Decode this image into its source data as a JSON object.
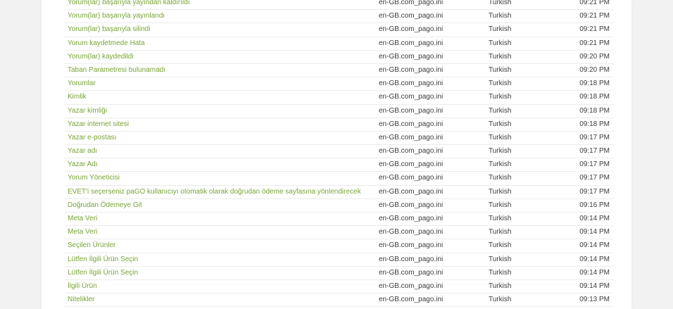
{
  "rows": [
    {
      "text": "Yorum(lar) başarıyla yayından kaldırıldı",
      "file": "en-GB.com_pago.ini",
      "language": "Turkish",
      "time": "09:21 PM"
    },
    {
      "text": "Yorum(lar) başarıyla yayınlandı",
      "file": "en-GB.com_pago.ini",
      "language": "Turkish",
      "time": "09:21 PM"
    },
    {
      "text": "Yorum(lar) başarıyla silindi",
      "file": "en-GB.com_pago.ini",
      "language": "Turkish",
      "time": "09:21 PM"
    },
    {
      "text": "Yorum kaydetmede Hata",
      "file": "en-GB.com_pago.ini",
      "language": "Turkish",
      "time": "09:21 PM"
    },
    {
      "text": "Yorum(lar) kaydedildi",
      "file": "en-GB.com_pago.ini",
      "language": "Turkish",
      "time": "09:20 PM"
    },
    {
      "text": "Taban Parametresi bulunamadı",
      "file": "en-GB.com_pago.ini",
      "language": "Turkish",
      "time": "09:20 PM"
    },
    {
      "text": "Yorumlar",
      "file": "en-GB.com_pago.ini",
      "language": "Turkish",
      "time": "09:18 PM"
    },
    {
      "text": "Kimlik",
      "file": "en-GB.com_pago.ini",
      "language": "Turkish",
      "time": "09:18 PM"
    },
    {
      "text": "Yazar kimliği",
      "file": "en-GB.com_pago.ini",
      "language": "Turkish",
      "time": "09:18 PM"
    },
    {
      "text": "Yazar internet sitesi",
      "file": "en-GB.com_pago.ini",
      "language": "Turkish",
      "time": "09:18 PM"
    },
    {
      "text": "Yazar e-postası",
      "file": "en-GB.com_pago.ini",
      "language": "Turkish",
      "time": "09:17 PM"
    },
    {
      "text": "Yazar adı",
      "file": "en-GB.com_pago.ini",
      "language": "Turkish",
      "time": "09:17 PM"
    },
    {
      "text": "Yazar Adı",
      "file": "en-GB.com_pago.ini",
      "language": "Turkish",
      "time": "09:17 PM"
    },
    {
      "text": "Yorum Yöneticisi",
      "file": "en-GB.com_pago.ini",
      "language": "Turkish",
      "time": "09:17 PM"
    },
    {
      "text": "EVET'i seçerseniz paGO kullanıcıyı otomatik olarak doğrudan ödeme sayfasına yönlendirecek",
      "file": "en-GB.com_pago.ini",
      "language": "Turkish",
      "time": "09:17 PM"
    },
    {
      "text": "Doğrudan Ödemeye Git",
      "file": "en-GB.com_pago.ini",
      "language": "Turkish",
      "time": "09:16 PM"
    },
    {
      "text": "Meta Veri",
      "file": "en-GB.com_pago.ini",
      "language": "Turkish",
      "time": "09:14 PM"
    },
    {
      "text": "Meta Veri",
      "file": "en-GB.com_pago.ini",
      "language": "Turkish",
      "time": "09:14 PM"
    },
    {
      "text": "Seçilen Ürünler",
      "file": "en-GB.com_pago.ini",
      "language": "Turkish",
      "time": "09:14 PM"
    },
    {
      "text": "Lütfen İlgili Ürün Seçin",
      "file": "en-GB.com_pago.ini",
      "language": "Turkish",
      "time": "09:14 PM"
    },
    {
      "text": "Lütfen İlgili Ürün Seçin",
      "file": "en-GB.com_pago.ini",
      "language": "Turkish",
      "time": "09:14 PM"
    },
    {
      "text": "İlgili Ürün",
      "file": "en-GB.com_pago.ini",
      "language": "Turkish",
      "time": "09:14 PM"
    },
    {
      "text": "Nitelikler",
      "file": "en-GB.com_pago.ini",
      "language": "Turkish",
      "time": "09:13 PM"
    }
  ]
}
